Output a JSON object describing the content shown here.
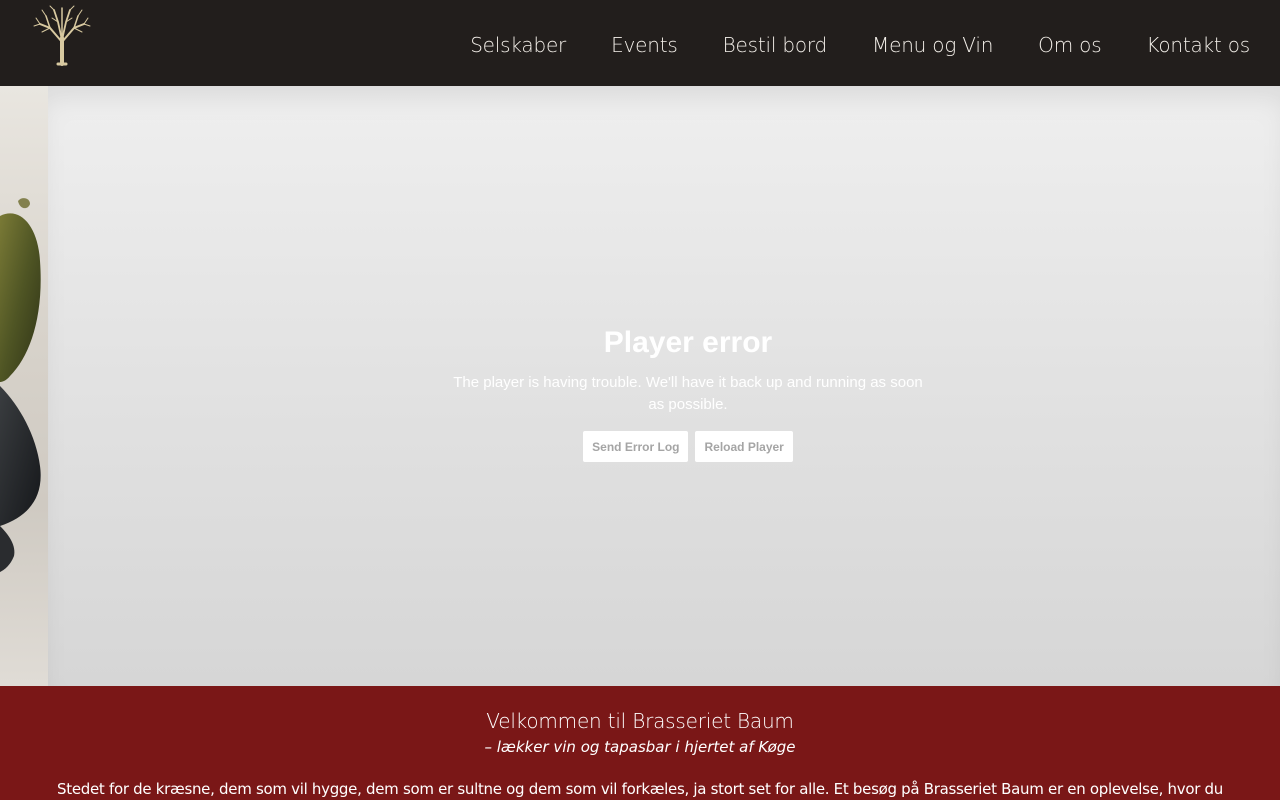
{
  "header": {
    "nav": [
      {
        "label": "Selskaber"
      },
      {
        "label": "Events"
      },
      {
        "label": "Bestil bord"
      },
      {
        "label": "Menu og Vin"
      },
      {
        "label": "Om os"
      },
      {
        "label": "Kontakt os"
      }
    ]
  },
  "player": {
    "title": "Player error",
    "message": "The player is having trouble. We'll have it back up and running as soon as possible.",
    "send_log_label": "Send Error Log",
    "reload_label": "Reload Player"
  },
  "welcome": {
    "title": "Velkommen til Brasseriet Baum",
    "subtitle": "– lækker vin og tapasbar i hjertet af Køge",
    "body": "Stedet for de kræsne, dem som vil hygge, dem som er sultne og dem som vil forkæles, ja stort set for alle. Et besøg på Brasseriet Baum er en oplevelse, hvor du"
  },
  "colors": {
    "header_bg": "#221e1c",
    "accent_red": "#7a1717",
    "logo_gold": "#d8c9a0"
  },
  "icons": {
    "logo": "tree-icon"
  }
}
